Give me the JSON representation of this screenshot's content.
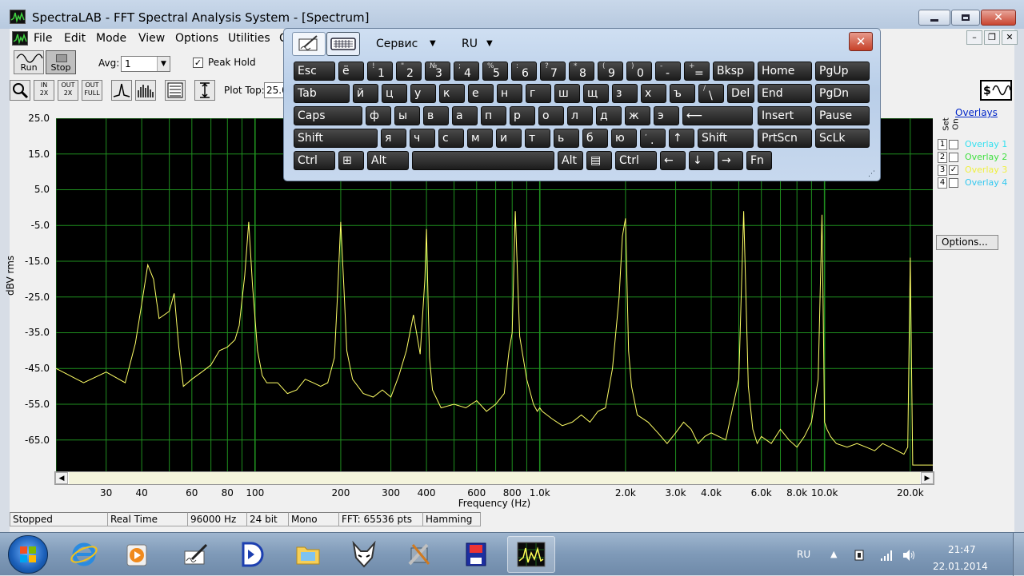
{
  "window": {
    "title": "SpectraLAB - FFT Spectral Analysis System - [Spectrum]"
  },
  "menu": {
    "items": [
      "File",
      "Edit",
      "Mode",
      "View",
      "Options",
      "Utilities",
      "C"
    ]
  },
  "toolbar": {
    "run_label": "Run",
    "stop_label": "Stop",
    "avg_label": "Avg:",
    "avg_value": "1",
    "peak_hold_label": "Peak Hold",
    "peak_hold_checked": true,
    "zoom_in_label": "IN",
    "zoom_in_sub": "2X",
    "zoom_out_label": "OUT",
    "zoom_out_sub": "2X",
    "zoom_full_label": "OUT",
    "zoom_full_sub": "FULL",
    "plot_top_label": "Plot Top:",
    "plot_top_value": "25.0"
  },
  "chart_data": {
    "type": "line",
    "title": "",
    "xlabel": "Frequency (Hz)",
    "ylabel": "dBV rms",
    "x_scale": "log",
    "xlim": [
      20,
      24000
    ],
    "ylim": [
      -74,
      25
    ],
    "yticks": [
      "25.0",
      "15.0",
      "5.0",
      "-5.0",
      "-15.0",
      "-25.0",
      "-35.0",
      "-45.0",
      "-55.0",
      "-65.0"
    ],
    "xticks": [
      "30",
      "40",
      "60",
      "80",
      "100",
      "200",
      "300",
      "400",
      "600",
      "800",
      "1.0k",
      "2.0k",
      "3.0k",
      "4.0k",
      "6.0k",
      "8.0k",
      "10.0k",
      "20.0k"
    ],
    "grid": true,
    "background": "#000000",
    "grid_color": "#1f8f1f",
    "series": [
      {
        "color": "#ffff66",
        "x": [
          20,
          25,
          30,
          35,
          38,
          40,
          42,
          44,
          46,
          48,
          50,
          52,
          54,
          56,
          58,
          60,
          65,
          70,
          75,
          80,
          85,
          88,
          92,
          95,
          98,
          102,
          106,
          110,
          120,
          130,
          140,
          150,
          160,
          170,
          180,
          190,
          195,
          200,
          205,
          210,
          220,
          240,
          260,
          280,
          300,
          320,
          340,
          360,
          380,
          395,
          400,
          405,
          410,
          420,
          450,
          500,
          550,
          600,
          650,
          700,
          750,
          780,
          800,
          820,
          850,
          900,
          950,
          980,
          1000,
          1020,
          1060,
          1100,
          1200,
          1300,
          1400,
          1500,
          1600,
          1700,
          1800,
          1900,
          1950,
          2000,
          2050,
          2100,
          2200,
          2400,
          2600,
          2800,
          3000,
          3200,
          3400,
          3600,
          3800,
          4000,
          4500,
          5000,
          5200,
          5400,
          5600,
          5800,
          6000,
          6500,
          7000,
          7500,
          8000,
          8500,
          9000,
          9500,
          9800,
          10000,
          10200,
          10500,
          11000,
          12000,
          13000,
          14000,
          15000,
          16000,
          17000,
          18000,
          19000,
          19600,
          20000,
          20400,
          21000,
          22000,
          23000,
          24000
        ],
        "y": [
          -45,
          -49,
          -46,
          -49,
          -38,
          -27,
          -16,
          -20,
          -31,
          -30,
          -29,
          -24,
          -39,
          -50,
          -49,
          -48,
          -46,
          -44,
          -40,
          -39,
          -37,
          -33,
          -19,
          -4,
          -22,
          -40,
          -47,
          -49,
          -49,
          -52,
          -51,
          -48,
          -49,
          -50,
          -49,
          -42,
          -24,
          -4,
          -22,
          -40,
          -48,
          -52,
          -53,
          -51,
          -53,
          -47,
          -40,
          -30,
          -41,
          -20,
          -6,
          -25,
          -42,
          -51,
          -56,
          -55,
          -56,
          -54,
          -57,
          -55,
          -52,
          -40,
          -35,
          -1,
          -36,
          -48,
          -55,
          -57,
          -56,
          -57,
          -58,
          -59,
          -61,
          -60,
          -58,
          -60,
          -57,
          -56,
          -45,
          -25,
          -8,
          -3,
          -40,
          -50,
          -58,
          -60,
          -63,
          -66,
          -63,
          -60,
          -62,
          -66,
          -64,
          -63,
          -65,
          -48,
          -1,
          -50,
          -62,
          -66,
          -64,
          -66,
          -62,
          -65,
          -67,
          -64,
          -60,
          -48,
          -2,
          -60,
          -62,
          -64,
          -66,
          -67,
          -66,
          -67,
          -68,
          -66,
          -67,
          -68,
          -69,
          -67,
          -14,
          -72,
          -72,
          -72,
          -72,
          -72
        ]
      }
    ]
  },
  "overlays": {
    "title": "Overlays",
    "set_label": "Set",
    "on_label": "On",
    "items": [
      {
        "num": "1",
        "name": "Overlay 1",
        "color": "#33e0f0",
        "checked": false
      },
      {
        "num": "2",
        "name": "Overlay 2",
        "color": "#40e040",
        "checked": false
      },
      {
        "num": "3",
        "name": "Overlay 3",
        "color": "#f0f040",
        "checked": true
      },
      {
        "num": "4",
        "name": "Overlay 4",
        "color": "#33c8f0",
        "checked": false
      }
    ],
    "options_label": "Options..."
  },
  "statusbar": {
    "cells": [
      "Stopped",
      "Real Time",
      "96000 Hz",
      "24 bit",
      "Mono",
      "FFT: 65536 pts",
      "Hamming"
    ]
  },
  "osk": {
    "service_label": "Сервис",
    "lang_label": "RU",
    "close_symbol": "✕",
    "rows": [
      [
        {
          "t": "Esc",
          "w": 52
        },
        {
          "t": "ё",
          "w": 32
        },
        {
          "s": "!",
          "t": "1",
          "w": 32
        },
        {
          "s": "\"",
          "t": "2",
          "w": 32
        },
        {
          "s": "№",
          "t": "3",
          "w": 32
        },
        {
          "s": ";",
          "t": "4",
          "w": 32
        },
        {
          "s": "%",
          "t": "5",
          "w": 32
        },
        {
          "s": ":",
          "t": "6",
          "w": 32
        },
        {
          "s": "?",
          "t": "7",
          "w": 32
        },
        {
          "s": "*",
          "t": "8",
          "w": 32
        },
        {
          "s": "(",
          "t": "9",
          "w": 32
        },
        {
          "s": ")",
          "t": "0",
          "w": 32
        },
        {
          "s": "-",
          "t": "-",
          "w": 32
        },
        {
          "s": "+",
          "t": "=",
          "w": 32
        },
        {
          "t": "Bksp",
          "w": 52
        }
      ],
      [
        {
          "t": "Tab",
          "w": 70
        },
        {
          "t": "й",
          "w": 32
        },
        {
          "t": "ц",
          "w": 32
        },
        {
          "t": "у",
          "w": 32
        },
        {
          "t": "к",
          "w": 32
        },
        {
          "t": "е",
          "w": 32
        },
        {
          "t": "н",
          "w": 32
        },
        {
          "t": "г",
          "w": 32
        },
        {
          "t": "ш",
          "w": 32
        },
        {
          "t": "щ",
          "w": 32
        },
        {
          "t": "з",
          "w": 32
        },
        {
          "t": "х",
          "w": 32
        },
        {
          "t": "ъ",
          "w": 32
        },
        {
          "s": "/",
          "t": "\\",
          "w": 32
        },
        {
          "t": "Del",
          "w": 34
        }
      ],
      [
        {
          "t": "Caps",
          "w": 86
        },
        {
          "t": "ф",
          "w": 32
        },
        {
          "t": "ы",
          "w": 32
        },
        {
          "t": "в",
          "w": 32
        },
        {
          "t": "а",
          "w": 32
        },
        {
          "t": "п",
          "w": 32
        },
        {
          "t": "р",
          "w": 32
        },
        {
          "t": "о",
          "w": 32
        },
        {
          "t": "л",
          "w": 32
        },
        {
          "t": "д",
          "w": 32
        },
        {
          "t": "ж",
          "w": 32
        },
        {
          "t": "э",
          "w": 32
        },
        {
          "t": "⟵",
          "w": 88
        }
      ],
      [
        {
          "t": "Shift",
          "w": 105
        },
        {
          "t": "я",
          "w": 32
        },
        {
          "t": "ч",
          "w": 32
        },
        {
          "t": "с",
          "w": 32
        },
        {
          "t": "м",
          "w": 32
        },
        {
          "t": "и",
          "w": 32
        },
        {
          "t": "т",
          "w": 32
        },
        {
          "t": "ь",
          "w": 32
        },
        {
          "t": "б",
          "w": 32
        },
        {
          "t": "ю",
          "w": 32
        },
        {
          "s": ",",
          "t": ".",
          "w": 32
        },
        {
          "t": "↑",
          "w": 32
        },
        {
          "t": "Shift",
          "w": 70
        }
      ],
      [
        {
          "t": "Ctrl",
          "w": 52
        },
        {
          "t": "⊞",
          "w": 32
        },
        {
          "t": "Alt",
          "w": 52
        },
        {
          "t": "",
          "w": 178
        },
        {
          "t": "Alt",
          "w": 32
        },
        {
          "t": "▤",
          "w": 32
        },
        {
          "t": "Ctrl",
          "w": 52
        },
        {
          "t": "←",
          "w": 32
        },
        {
          "t": "↓",
          "w": 32
        },
        {
          "t": "→",
          "w": 32
        },
        {
          "t": "Fn",
          "w": 32
        }
      ]
    ],
    "nav_keys": [
      [
        "Home",
        "PgUp"
      ],
      [
        "End",
        "PgDn"
      ],
      [
        "Insert",
        "Pause"
      ],
      [
        "PrtScn",
        "ScLk"
      ]
    ]
  },
  "taskbar": {
    "tray_lang": "RU",
    "time": "21:47",
    "date": "22.01.2014"
  }
}
